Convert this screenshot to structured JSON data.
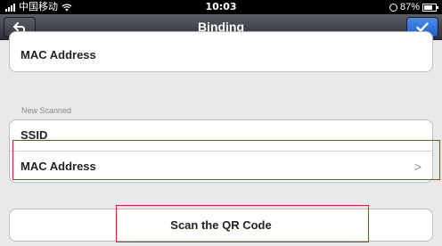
{
  "statusbar": {
    "carrier": "中国移动",
    "time": "10:03",
    "battery_percent": "87%"
  },
  "navbar": {
    "title": "Binding",
    "back_icon": "back-arrow-icon",
    "done_icon": "checkmark-icon"
  },
  "top_group": {
    "mac_label": "MAC Address"
  },
  "new_scanned": {
    "section_label": "New Scanned",
    "ssid_label": "SSID",
    "mac_label": "MAC Address",
    "chevron": ">"
  },
  "scan_button": {
    "label": "Scan the QR Code"
  },
  "colors": {
    "highlight": "#e3221e",
    "done_button": "#1d5fc7"
  }
}
